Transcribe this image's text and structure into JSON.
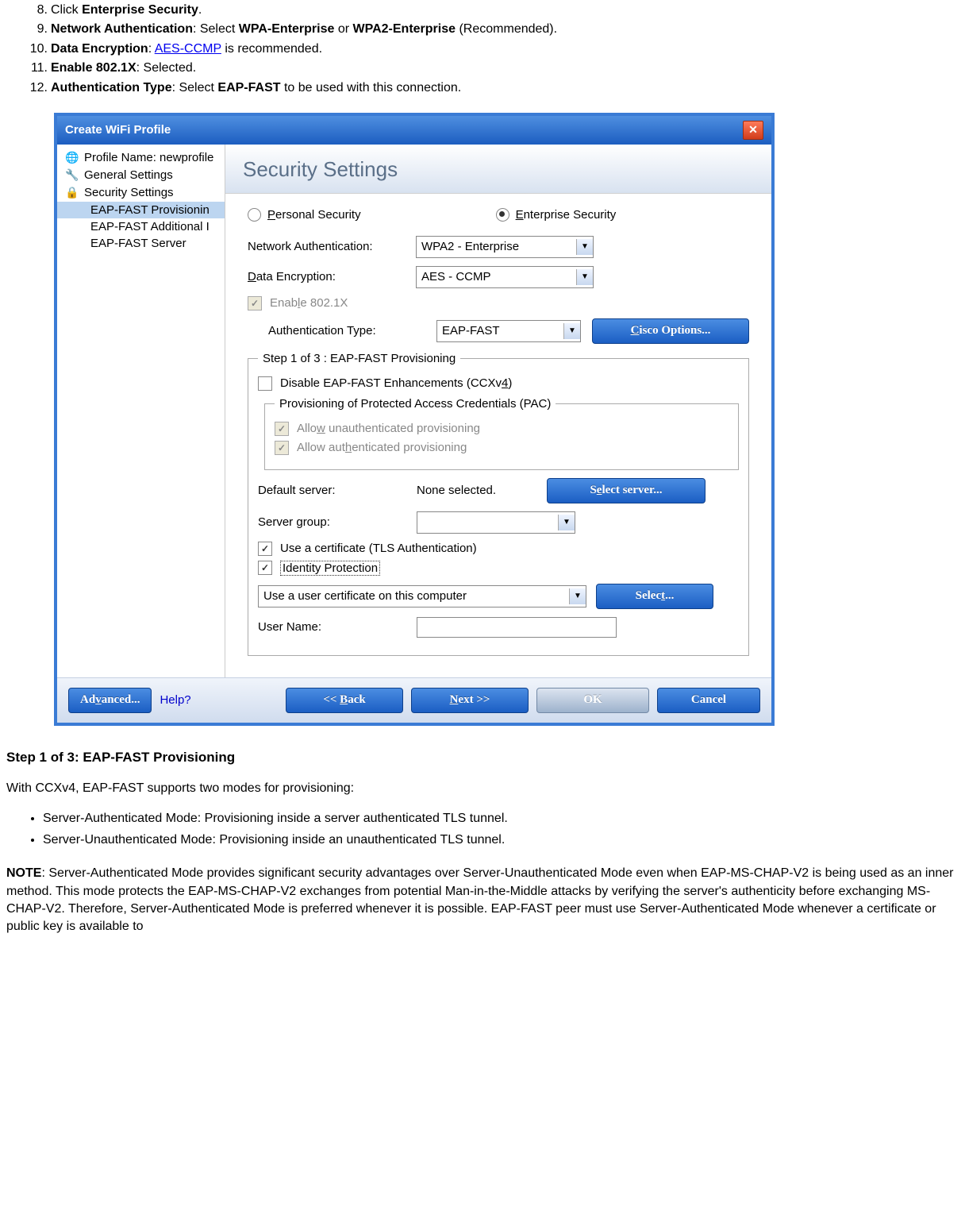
{
  "steps": [
    {
      "numText": "8.",
      "prefix": "Click ",
      "bold": "Enterprise Security",
      "suffix": "."
    },
    {
      "numText": "9.",
      "bold": "Network Authentication",
      "middle": ": Select ",
      "bold2": "WPA-Enterprise",
      "or": " or ",
      "bold3": "WPA2-Enterprise",
      "end": " (Recommended)."
    },
    {
      "numText": "10.",
      "bold": "Data Encryption",
      "middle": ": ",
      "link": "AES-CCMP",
      "end": " is recommended."
    },
    {
      "numText": "11.",
      "bold": "Enable 802.1X",
      "end": ": Selected."
    },
    {
      "numText": "12.",
      "bold": "Authentication Type",
      "middle": ": Select ",
      "bold2": "EAP-FAST",
      "end": " to be used with this connection."
    }
  ],
  "dialog": {
    "title": "Create WiFi Profile",
    "closeSymbol": "✕",
    "tree": {
      "items": [
        {
          "label": "Profile Name: newprofile",
          "icon": "globe"
        },
        {
          "label": "General Settings",
          "icon": "cog"
        },
        {
          "label": "Security Settings",
          "icon": "lock"
        },
        {
          "label": "EAP-FAST Provisionin",
          "level": 2,
          "selected": true
        },
        {
          "label": "EAP-FAST Additional I",
          "level": 2
        },
        {
          "label": "EAP-FAST Server",
          "level": 2
        }
      ]
    },
    "heading": "Security Settings",
    "radios": {
      "personal": "Personal Security",
      "enterprise": "Enterprise Security"
    },
    "netauth": {
      "label": "Network Authentication:",
      "value": "WPA2 - Enterprise"
    },
    "dataenc": {
      "label": "Data Encryption:",
      "value": "AES - CCMP"
    },
    "enable8021x": "Enable 802.1X",
    "authtype": {
      "label": "Authentication Type:",
      "value": "EAP-FAST"
    },
    "ciscoBtn": "Cisco Options...",
    "step1": {
      "legend": "Step 1 of 3 : EAP-FAST Provisioning",
      "disableEnh": "Disable EAP-FAST Enhancements (CCXv4)",
      "pacLegend": "Provisioning of Protected Access Credentials (PAC)",
      "allowUnauth": "Allow unauthenticated provisioning",
      "allowAuth": "Allow authenticated provisioning",
      "defaultServer": {
        "label": "Default server:",
        "value": "None selected."
      },
      "selectServerBtn": "Select server...",
      "serverGroup": {
        "label": "Server group:",
        "value": ""
      },
      "useCert": "Use a certificate (TLS Authentication)",
      "identityProt": "Identity Protection",
      "userCert": "Use a user certificate on this computer",
      "selectBtn": "Select...",
      "userName": {
        "label": "User Name:",
        "value": ""
      }
    },
    "footer": {
      "advanced": "Advanced...",
      "help": "Help?",
      "back": "<< Back",
      "next": "Next >>",
      "ok": "OK",
      "cancel": "Cancel"
    }
  },
  "stepHeading": "Step 1 of 3: EAP-FAST Provisioning",
  "para1": "With CCXv4, EAP-FAST supports two modes for provisioning:",
  "modes": [
    "Server-Authenticated Mode: Provisioning inside a server authenticated TLS tunnel.",
    "Server-Unauthenticated Mode: Provisioning inside an unauthenticated TLS tunnel."
  ],
  "notePrefix": "NOTE",
  "noteBody": ": Server-Authenticated Mode provides significant security advantages over Server-Unauthenticated Mode even when EAP-MS-CHAP-V2 is being used as an inner method. This mode protects the EAP-MS-CHAP-V2 exchanges from potential Man-in-the-Middle attacks by verifying the server's authenticity before exchanging MS-CHAP-V2. Therefore, Server-Authenticated Mode is preferred whenever it is possible. EAP-FAST peer must use Server-Authenticated Mode whenever a certificate or public key is available to"
}
